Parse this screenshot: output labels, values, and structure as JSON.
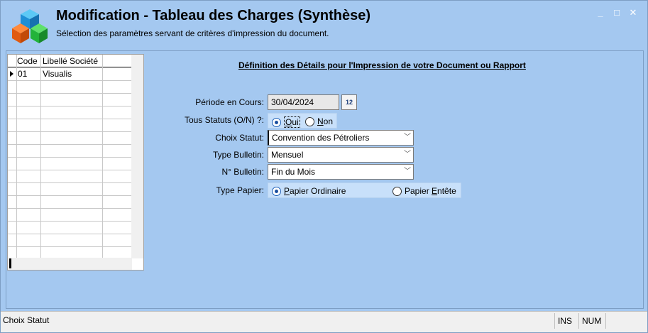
{
  "window": {
    "title": "Modification - Tableau des Charges (Synthèse)",
    "subtitle": "Sélection des paramètres servant de critères d'impression du document.",
    "controls": {
      "minimize": "_",
      "maximize": "□",
      "close": "✕"
    }
  },
  "grid": {
    "headers": {
      "code": "Code",
      "libelle": "Libellé Société"
    },
    "rows": [
      {
        "code": "01",
        "libelle": "Visualis"
      }
    ]
  },
  "form": {
    "section_title": "Définition des Détails pour l'Impression de votre Document ou Rapport",
    "periode": {
      "label": "Période en Cours:",
      "value": "30/04/2024",
      "cal_icon": "12"
    },
    "tous_statuts": {
      "label": "Tous Statuts (O/N) ?:",
      "oui": "Oui",
      "non": "Non",
      "selected": "Oui"
    },
    "choix_statut": {
      "label": "Choix Statut:",
      "value": "Convention des Pétroliers"
    },
    "type_bulletin": {
      "label": "Type Bulletin:",
      "value": "Mensuel"
    },
    "num_bulletin": {
      "label": "N° Bulletin:",
      "value": "Fin du Mois"
    },
    "type_papier": {
      "label": "Type Papier:",
      "ordinaire": "Papier Ordinaire",
      "entete": "Papier Entête",
      "selected": "Papier Ordinaire"
    }
  },
  "statusbar": {
    "text": "Choix Statut",
    "ins": "INS",
    "num": "NUM"
  }
}
